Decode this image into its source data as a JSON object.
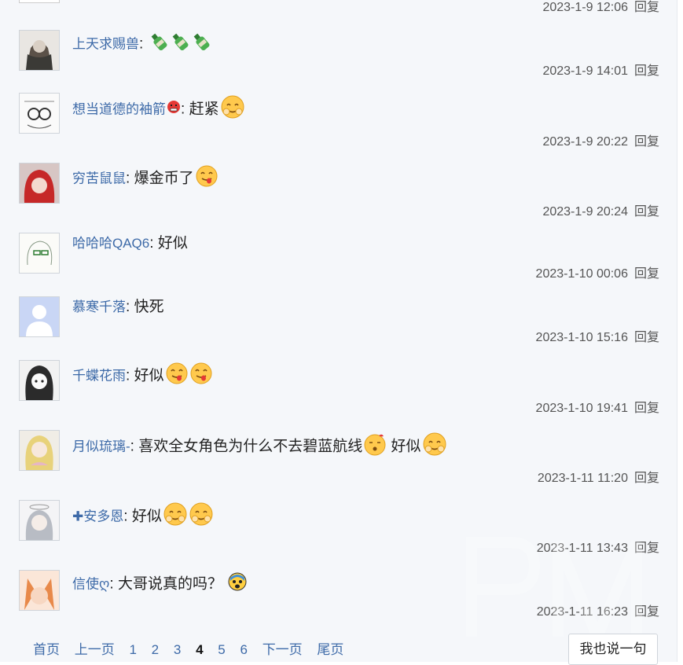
{
  "top_partial": {
    "time": "2023-1-9 12:06",
    "reply_label": "回复"
  },
  "comments": [
    {
      "username": "上天求赐兽",
      "separator": ":",
      "text": "",
      "emojis": [
        "bottle",
        "bottle",
        "bottle"
      ],
      "text_after": "",
      "time": "2023-1-9 14:01",
      "reply_label": "回复"
    },
    {
      "username": "想当道德的袖箭",
      "user_badge": "angry-face",
      "separator": ":",
      "text": "赶紧",
      "emojis": [
        "smile-cheeks"
      ],
      "text_after": "",
      "time": "2023-1-9 20:22",
      "reply_label": "回复"
    },
    {
      "username": "穷苦鼠鼠",
      "separator": ":",
      "text": "爆金币了",
      "emojis": [
        "tongue-face"
      ],
      "text_after": "",
      "time": "2023-1-9 20:24",
      "reply_label": "回复"
    },
    {
      "username": "哈哈哈QAQ6",
      "separator": ":",
      "text": "好似",
      "emojis": [],
      "text_after": "",
      "time": "2023-1-10 00:06",
      "reply_label": "回复"
    },
    {
      "username": "慕寒千落",
      "separator": ":",
      "text": "快死",
      "emojis": [],
      "text_after": "",
      "time": "2023-1-10 15:16",
      "reply_label": "回复"
    },
    {
      "username": "千蝶花雨",
      "separator": ":",
      "text": "好似",
      "emojis": [
        "tongue-face",
        "tongue-face"
      ],
      "text_after": "",
      "time": "2023-1-10 19:41",
      "reply_label": "回复"
    },
    {
      "username": "月似琉璃-",
      "separator": ":",
      "text": "喜欢全女角色为什么不去碧蓝航线",
      "emojis": [
        "dizzy-face"
      ],
      "text_after": "好似",
      "emojis_after": [
        "smile-cheeks"
      ],
      "time": "2023-1-11 11:20",
      "reply_label": "回复"
    },
    {
      "username": "安多恩",
      "user_prefix": "✚",
      "separator": ":",
      "text": "好似",
      "emojis": [
        "smile-cheeks",
        "smile-cheeks"
      ],
      "text_after": "",
      "time": "2023-1-11 13:43",
      "reply_label": "回复"
    },
    {
      "username": "信使ღ",
      "separator": ":",
      "text": "大哥说真的吗？",
      "emojis": [
        "scared-face"
      ],
      "text_after": "",
      "time": "2023-1-11 16:23",
      "reply_label": "回复"
    }
  ],
  "pagination": {
    "first": "首页",
    "prev": "上一页",
    "pages": [
      "1",
      "2",
      "3",
      "4",
      "5",
      "6"
    ],
    "current": "4",
    "next": "下一页",
    "last": "尾页"
  },
  "say_button": "我也说一句"
}
